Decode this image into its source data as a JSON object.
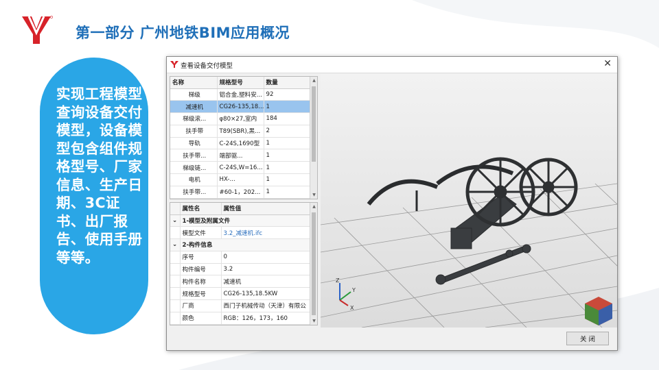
{
  "header": {
    "title": "第一部分 广州地铁BIM应用概况"
  },
  "left_panel": {
    "text": "实现工程模型查询设备交付模型，设备模型包含组件规格型号、厂家信息、生产日期、3C证书、出厂报告、使用手册等等。"
  },
  "dialog": {
    "title": "查看设备交付模型",
    "close_label": "关 闭",
    "device_table": {
      "columns": [
        "名称",
        "规格型号",
        "数量"
      ],
      "rows": [
        [
          "梯级",
          "铝合金,塑料安...",
          "92"
        ],
        [
          "减速机",
          "CG26-135,18...",
          "1"
        ],
        [
          "梯级滚...",
          "φ80×27,室内",
          "184"
        ],
        [
          "扶手带",
          "T89(SBR),黑...",
          "2"
        ],
        [
          "导轨",
          "C-24S,1690型",
          "1"
        ],
        [
          "扶手带...",
          "端部驱...",
          "1"
        ],
        [
          "梯级链...",
          "C-24S,W=16...",
          "1"
        ],
        [
          "电机",
          "HX-...",
          "1"
        ],
        [
          "扶手带...",
          "#60-1，202...",
          "1"
        ]
      ],
      "selected_index": 1
    },
    "attr_table": {
      "columns": [
        "属性名",
        "属性值"
      ],
      "sections": [
        {
          "label": "1-模型及附属文件",
          "rows": [
            [
              "模型文件",
              "3.2_减速机.ifc"
            ]
          ]
        },
        {
          "label": "2-构件信息",
          "rows": [
            [
              "序号",
              "0"
            ],
            [
              "构件编号",
              "3.2"
            ],
            [
              "构件名称",
              "减速机"
            ],
            [
              "规格型号",
              "CG26-135,18.5KW"
            ],
            [
              "厂商",
              "西门子机械传动（天津）有限公"
            ],
            [
              "颜色",
              "RGB：126，173，160"
            ]
          ]
        }
      ]
    },
    "viewport": {
      "axis_labels": {
        "z": "Z",
        "y": "Y",
        "x": "X"
      }
    }
  },
  "colors": {
    "title": "#1f6fb8",
    "panel": "#2aa6e6",
    "selection": "#99c4ee",
    "link": "#2a6ebd"
  }
}
